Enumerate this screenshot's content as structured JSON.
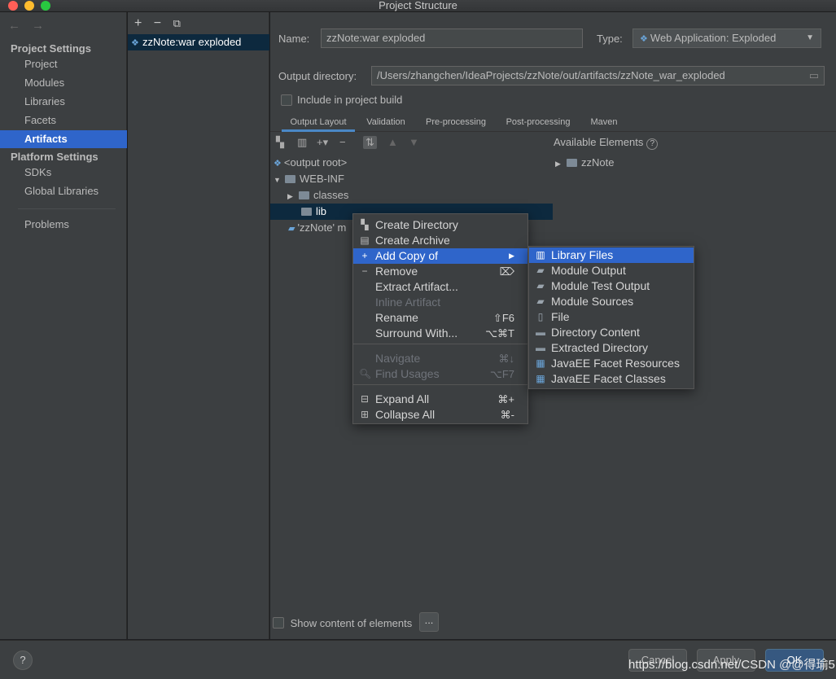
{
  "window": {
    "title": "Project Structure"
  },
  "nav": {
    "back": "←",
    "forward": "→",
    "project_settings_heading": "Project Settings",
    "project_items": [
      "Project",
      "Modules",
      "Libraries",
      "Facets",
      "Artifacts"
    ],
    "selected": "Artifacts",
    "platform_settings_heading": "Platform Settings",
    "platform_items": [
      "SDKs",
      "Global Libraries"
    ],
    "problems": "Problems"
  },
  "artifacts": {
    "add": "+",
    "remove": "−",
    "copy": "⧉",
    "items": [
      "zzNote:war exploded"
    ]
  },
  "form": {
    "name_label": "Name:",
    "name_value": "zzNote:war exploded",
    "type_label": "Type:",
    "type_value": "Web Application: Exploded",
    "output_label": "Output directory:",
    "output_value": "/Users/zhangchen/IdeaProjects/zzNote/out/artifacts/zzNote_war_exploded",
    "include_label": "Include in project build"
  },
  "tabs": [
    "Output Layout",
    "Validation",
    "Pre-processing",
    "Post-processing",
    "Maven"
  ],
  "active_tab": "Output Layout",
  "layout_tree": {
    "output_root": "<output root>",
    "web_inf": "WEB-INF",
    "classes": "classes",
    "lib": "lib",
    "module_output": "'zzNote' m"
  },
  "available": {
    "title": "Available Elements",
    "help": "?",
    "items": [
      "zzNote"
    ]
  },
  "show_content_label": "Show content of elements",
  "dots_label": "...",
  "context_menu": [
    {
      "label": "Create Directory",
      "icon": "new-folder-icon",
      "glyph": "▚",
      "key": ""
    },
    {
      "label": "Create Archive",
      "icon": "archive-icon",
      "glyph": "▤",
      "key": ""
    },
    {
      "label": "Add Copy of",
      "icon": "plus-icon",
      "glyph": "+",
      "key": "▶"
    },
    {
      "label": "Remove",
      "icon": "minus-icon",
      "glyph": "−",
      "key": "⌦"
    },
    {
      "label": "Extract Artifact...",
      "icon": "",
      "glyph": "",
      "key": ""
    },
    {
      "label": "Inline Artifact",
      "icon": "",
      "glyph": "",
      "key": ""
    },
    {
      "label": "Rename",
      "icon": "",
      "glyph": "",
      "key": "⇧F6"
    },
    {
      "label": "Surround With...",
      "icon": "",
      "glyph": "",
      "key": "⌥⌘T"
    },
    {
      "label": "Navigate",
      "icon": "",
      "glyph": "",
      "key": "⌘↓"
    },
    {
      "label": "Find Usages",
      "icon": "search-icon",
      "glyph": "🔍︎",
      "key": "⌥F7"
    },
    {
      "label": "Expand All",
      "icon": "expand-all-icon",
      "glyph": "⊟",
      "key": "⌘+"
    },
    {
      "label": "Collapse All",
      "icon": "collapse-all-icon",
      "glyph": "⊞",
      "key": "⌘-"
    }
  ],
  "submenu": [
    {
      "label": "Library Files",
      "icon": "library-icon",
      "glyph": "▥"
    },
    {
      "label": "Module Output",
      "icon": "module-output-icon",
      "glyph": "▰"
    },
    {
      "label": "Module Test Output",
      "icon": "module-test-output-icon",
      "glyph": "▰"
    },
    {
      "label": "Module Sources",
      "icon": "module-sources-icon",
      "glyph": "▰"
    },
    {
      "label": "File",
      "icon": "file-icon",
      "glyph": "▯"
    },
    {
      "label": "Directory Content",
      "icon": "folder-icon",
      "glyph": "▬"
    },
    {
      "label": "Extracted Directory",
      "icon": "extracted-directory-icon",
      "glyph": "▬"
    },
    {
      "label": "JavaEE Facet Resources",
      "icon": "javaee-resources-icon",
      "glyph": "▦"
    },
    {
      "label": "JavaEE Facet Classes",
      "icon": "javaee-classes-icon",
      "glyph": "▦"
    }
  ],
  "bottom": {
    "help": "?",
    "cancel": "Cancel",
    "apply": "Apply",
    "ok": "OK",
    "watermark": "https://blog.csdn.net/CSDN @@得瑜5"
  },
  "colors": {
    "accent": "#2f65ca",
    "selection_dark": "#0d293e",
    "panel": "#3c3f41"
  }
}
